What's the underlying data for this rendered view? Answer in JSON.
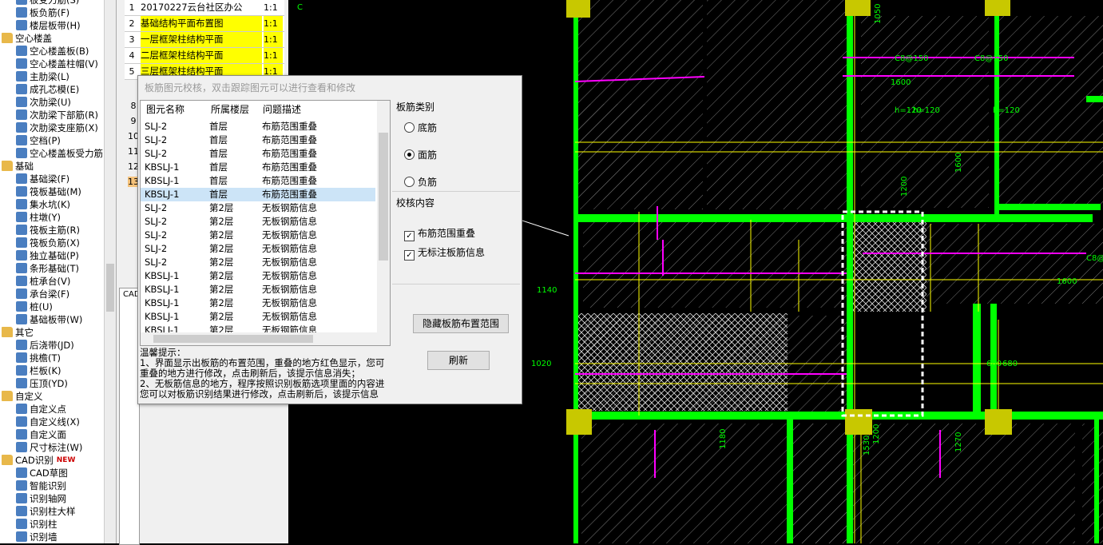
{
  "tree": {
    "items": [
      {
        "label": "板受力筋(S)",
        "kind": "item"
      },
      {
        "label": "板负筋(F)",
        "kind": "item"
      },
      {
        "label": "楼层板带(H)",
        "kind": "item"
      },
      {
        "label": "空心楼盖",
        "kind": "folder"
      },
      {
        "label": "空心楼盖板(B)",
        "kind": "item"
      },
      {
        "label": "空心楼盖柱帽(V)",
        "kind": "item"
      },
      {
        "label": "主肋梁(L)",
        "kind": "item"
      },
      {
        "label": "成孔芯模(E)",
        "kind": "item"
      },
      {
        "label": "次肋梁(U)",
        "kind": "item"
      },
      {
        "label": "次肋梁下部筋(R)",
        "kind": "item"
      },
      {
        "label": "次肋梁支座筋(X)",
        "kind": "item"
      },
      {
        "label": "空档(P)",
        "kind": "item"
      },
      {
        "label": "空心楼盖板受力筋",
        "kind": "item"
      },
      {
        "label": "基础",
        "kind": "folder"
      },
      {
        "label": "基础梁(F)",
        "kind": "item"
      },
      {
        "label": "筏板基础(M)",
        "kind": "item"
      },
      {
        "label": "集水坑(K)",
        "kind": "item"
      },
      {
        "label": "柱墩(Y)",
        "kind": "item"
      },
      {
        "label": "筏板主筋(R)",
        "kind": "item"
      },
      {
        "label": "筏板负筋(X)",
        "kind": "item"
      },
      {
        "label": "独立基础(P)",
        "kind": "item"
      },
      {
        "label": "条形基础(T)",
        "kind": "item"
      },
      {
        "label": "桩承台(V)",
        "kind": "item"
      },
      {
        "label": "承台梁(F)",
        "kind": "item"
      },
      {
        "label": "桩(U)",
        "kind": "item"
      },
      {
        "label": "基础板带(W)",
        "kind": "item"
      },
      {
        "label": "其它",
        "kind": "folder"
      },
      {
        "label": "后浇带(JD)",
        "kind": "item"
      },
      {
        "label": "挑檐(T)",
        "kind": "item"
      },
      {
        "label": "栏板(K)",
        "kind": "item"
      },
      {
        "label": "压顶(YD)",
        "kind": "item"
      },
      {
        "label": "自定义",
        "kind": "folder"
      },
      {
        "label": "自定义点",
        "kind": "item"
      },
      {
        "label": "自定义线(X)",
        "kind": "item"
      },
      {
        "label": "自定义面",
        "kind": "item"
      },
      {
        "label": "尺寸标注(W)",
        "kind": "item"
      },
      {
        "label": "CAD识别",
        "kind": "folder",
        "badge": "NEW"
      },
      {
        "label": "CAD草图",
        "kind": "item"
      },
      {
        "label": "智能识别",
        "kind": "item"
      },
      {
        "label": "识别轴网",
        "kind": "item"
      },
      {
        "label": "识别柱大样",
        "kind": "item"
      },
      {
        "label": "识别柱",
        "kind": "item"
      },
      {
        "label": "识别墙",
        "kind": "item"
      }
    ]
  },
  "floors": {
    "rows": [
      {
        "num": "1",
        "name": "20170227云台社区办公",
        "scale": "1:1",
        "hl": false
      },
      {
        "num": "2",
        "name": "基础结构平面布置图",
        "scale": "1:1",
        "hl": true
      },
      {
        "num": "3",
        "name": "一层框架柱结构平面",
        "scale": "1:1",
        "hl": true
      },
      {
        "num": "4",
        "name": "二层框架柱结构平面",
        "scale": "1:1",
        "hl": true
      },
      {
        "num": "5",
        "name": "三层框架柱结构平面",
        "scale": "1:1",
        "hl": true
      }
    ],
    "more_nums": [
      "8",
      "9",
      "10",
      "11",
      "12",
      "13"
    ],
    "cad_label": "CAD"
  },
  "dialog": {
    "title": "板筋图元校核，双击跟踪图元可以进行查看和修改",
    "columns": [
      "图元名称",
      "所属楼层",
      "问题描述"
    ],
    "rows": [
      [
        "SLJ-2",
        "首层",
        "布筋范围重叠"
      ],
      [
        "SLJ-2",
        "首层",
        "布筋范围重叠"
      ],
      [
        "SLJ-2",
        "首层",
        "布筋范围重叠"
      ],
      [
        "KBSLJ-1",
        "首层",
        "布筋范围重叠"
      ],
      [
        "KBSLJ-1",
        "首层",
        "布筋范围重叠"
      ],
      [
        "KBSLJ-1",
        "首层",
        "布筋范围重叠"
      ],
      [
        "SLJ-2",
        "第2层",
        "无板钢筋信息"
      ],
      [
        "SLJ-2",
        "第2层",
        "无板钢筋信息"
      ],
      [
        "SLJ-2",
        "第2层",
        "无板钢筋信息"
      ],
      [
        "SLJ-2",
        "第2层",
        "无板钢筋信息"
      ],
      [
        "SLJ-2",
        "第2层",
        "无板钢筋信息"
      ],
      [
        "KBSLJ-1",
        "第2层",
        "无板钢筋信息"
      ],
      [
        "KBSLJ-1",
        "第2层",
        "无板钢筋信息"
      ],
      [
        "KBSLJ-1",
        "第2层",
        "无板钢筋信息"
      ],
      [
        "KBSLJ-1",
        "第2层",
        "无板钢筋信息"
      ],
      [
        "KBSLJ-1",
        "第2层",
        "无板钢筋信息"
      ]
    ],
    "selected_row": 5,
    "tips": [
      "温馨提示：",
      "1、界面显示出板筋的布置范围，重叠的地方红色显示，您可",
      "重叠的地方进行修改，点击刷新后，该提示信息消失；",
      "2、无板筋信息的地方，程序按照识别板筋选项里面的内容进",
      "您可以对板筋识别结果进行修改，点击刷新后，该提示信息"
    ],
    "category_label": "板筋类别",
    "categories": [
      "底筋",
      "面筋",
      "负筋"
    ],
    "selected_category": "面筋",
    "check_label": "校核内容",
    "checks": [
      "布筋范围重叠",
      "无标注板筋信息"
    ],
    "hide_button": "隐藏板筋布置范围",
    "refresh_button": "刷新"
  },
  "cad": {
    "texts": [
      "1050",
      "C8@150",
      "1600",
      "C8@150",
      "h=120",
      "h=120",
      "h=120",
      "C8@125",
      "1600",
      "1140",
      "1020",
      "680",
      "680",
      "1180",
      "1200",
      "1270",
      "1200",
      "1530",
      "1600",
      "C"
    ],
    "colors": {
      "green": "#00ff00",
      "yellow": "#ffff00",
      "magenta": "#ff00ff",
      "olive": "#c8c800",
      "white": "#ffffff"
    }
  }
}
